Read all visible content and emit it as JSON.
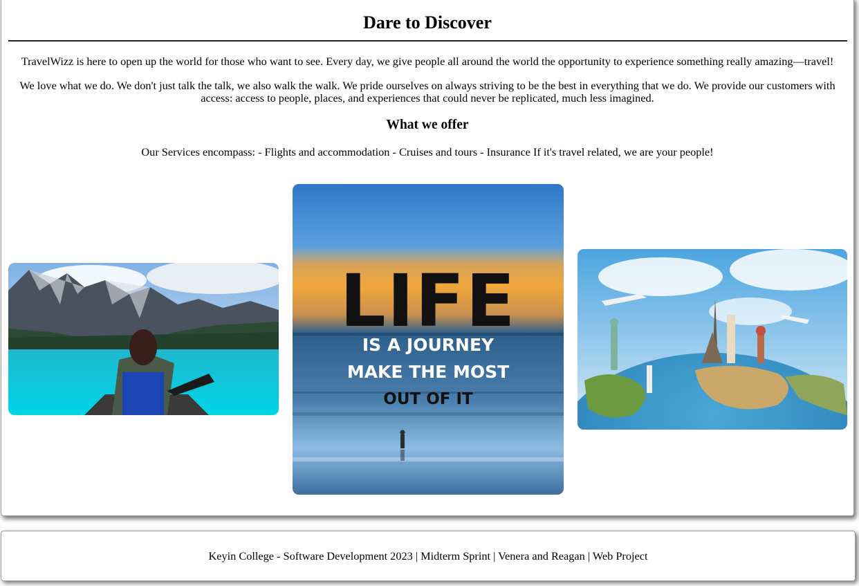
{
  "main": {
    "title": "Dare to Discover",
    "intro": "TravelWizz is here to open up the world for those who want to see. Every day, we give people all around the world the opportunity to experience something really amazing—travel!",
    "about": "We love what we do. We don't just talk the talk, we also walk the walk. We pride ourselves on always striving to be the best in everything that we do. We provide our customers with access: access to people, places, and experiences that could never be replicated, much less imagined.",
    "offer_heading": "What we offer",
    "services": "Our Services encompass: - Flights and accommodation - Cruises and tours - Insurance If it's travel related, we are your people!"
  },
  "gallery": {
    "poster_line1": "LIFE",
    "poster_line2": "IS A JOURNEY",
    "poster_line3": "MAKE THE MOST",
    "poster_line4": "OUT OF IT"
  },
  "footer": {
    "text": "Keyin College - Software Development 2023 | Midterm Sprint | Venera and Reagan | Web Project"
  }
}
